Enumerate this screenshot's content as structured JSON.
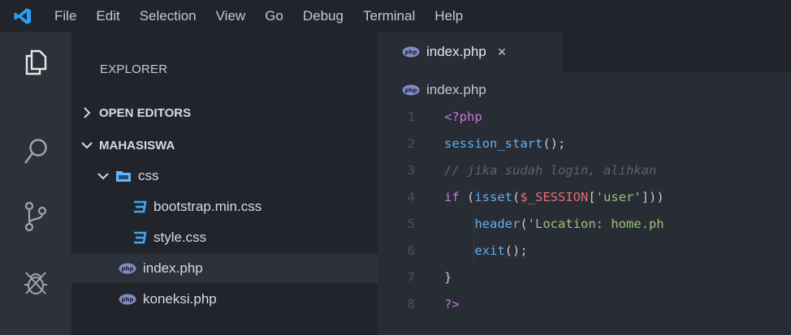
{
  "menu": {
    "items": [
      "File",
      "Edit",
      "Selection",
      "View",
      "Go",
      "Debug",
      "Terminal",
      "Help"
    ]
  },
  "activity_bar": {
    "icons": [
      "explorer-icon",
      "search-icon",
      "source-control-icon",
      "debug-icon"
    ]
  },
  "sidebar": {
    "title": "EXPLORER",
    "sections": {
      "open_editors": "OPEN EDITORS",
      "project": "MAHASISWA"
    },
    "tree": [
      {
        "label": "css",
        "type": "folder",
        "depth": 1
      },
      {
        "label": "bootstrap.min.css",
        "type": "css",
        "depth": 2
      },
      {
        "label": "style.css",
        "type": "css",
        "depth": 2
      },
      {
        "label": "index.php",
        "type": "php",
        "depth": 1,
        "selected": true
      },
      {
        "label": "koneksi.php",
        "type": "php",
        "depth": 1
      }
    ]
  },
  "editor": {
    "tab": {
      "label": "index.php",
      "close": "×"
    },
    "breadcrumb": "index.php",
    "line_numbers": [
      "1",
      "2",
      "3",
      "4",
      "5",
      "6",
      "7",
      "8"
    ],
    "lines": [
      {
        "tokens": [
          {
            "t": "<?php",
            "c": "kw"
          }
        ]
      },
      {
        "tokens": [
          {
            "t": "session_start",
            "c": "fn"
          },
          {
            "t": "();",
            "c": "pl"
          }
        ]
      },
      {
        "tokens": [
          {
            "t": "// jika sudah login, alihkan",
            "c": "cm"
          }
        ]
      },
      {
        "tokens": [
          {
            "t": "if",
            "c": "kw"
          },
          {
            "t": " (",
            "c": "pl"
          },
          {
            "t": "isset",
            "c": "fn"
          },
          {
            "t": "(",
            "c": "pl"
          },
          {
            "t": "$_SESSION",
            "c": "var"
          },
          {
            "t": "[",
            "c": "pl"
          },
          {
            "t": "'user'",
            "c": "str"
          },
          {
            "t": "]))",
            "c": "pl"
          }
        ]
      },
      {
        "tokens": [
          {
            "t": "    ",
            "c": "pl"
          },
          {
            "t": "header",
            "c": "fn"
          },
          {
            "t": "(",
            "c": "pl"
          },
          {
            "t": "'Location: home.ph",
            "c": "str"
          }
        ],
        "guide": true
      },
      {
        "tokens": [
          {
            "t": "    ",
            "c": "pl"
          },
          {
            "t": "exit",
            "c": "fn"
          },
          {
            "t": "();",
            "c": "pl"
          }
        ],
        "guide": true
      },
      {
        "tokens": [
          {
            "t": "}",
            "c": "pl"
          }
        ]
      },
      {
        "tokens": [
          {
            "t": "?>",
            "c": "kw"
          }
        ]
      }
    ]
  },
  "colors": {
    "php_icon": "#7f8cc4",
    "css_icon": "#42a5f5",
    "folder_icon": "#64b5f6",
    "vscode_blue": "#2aa0f5"
  }
}
